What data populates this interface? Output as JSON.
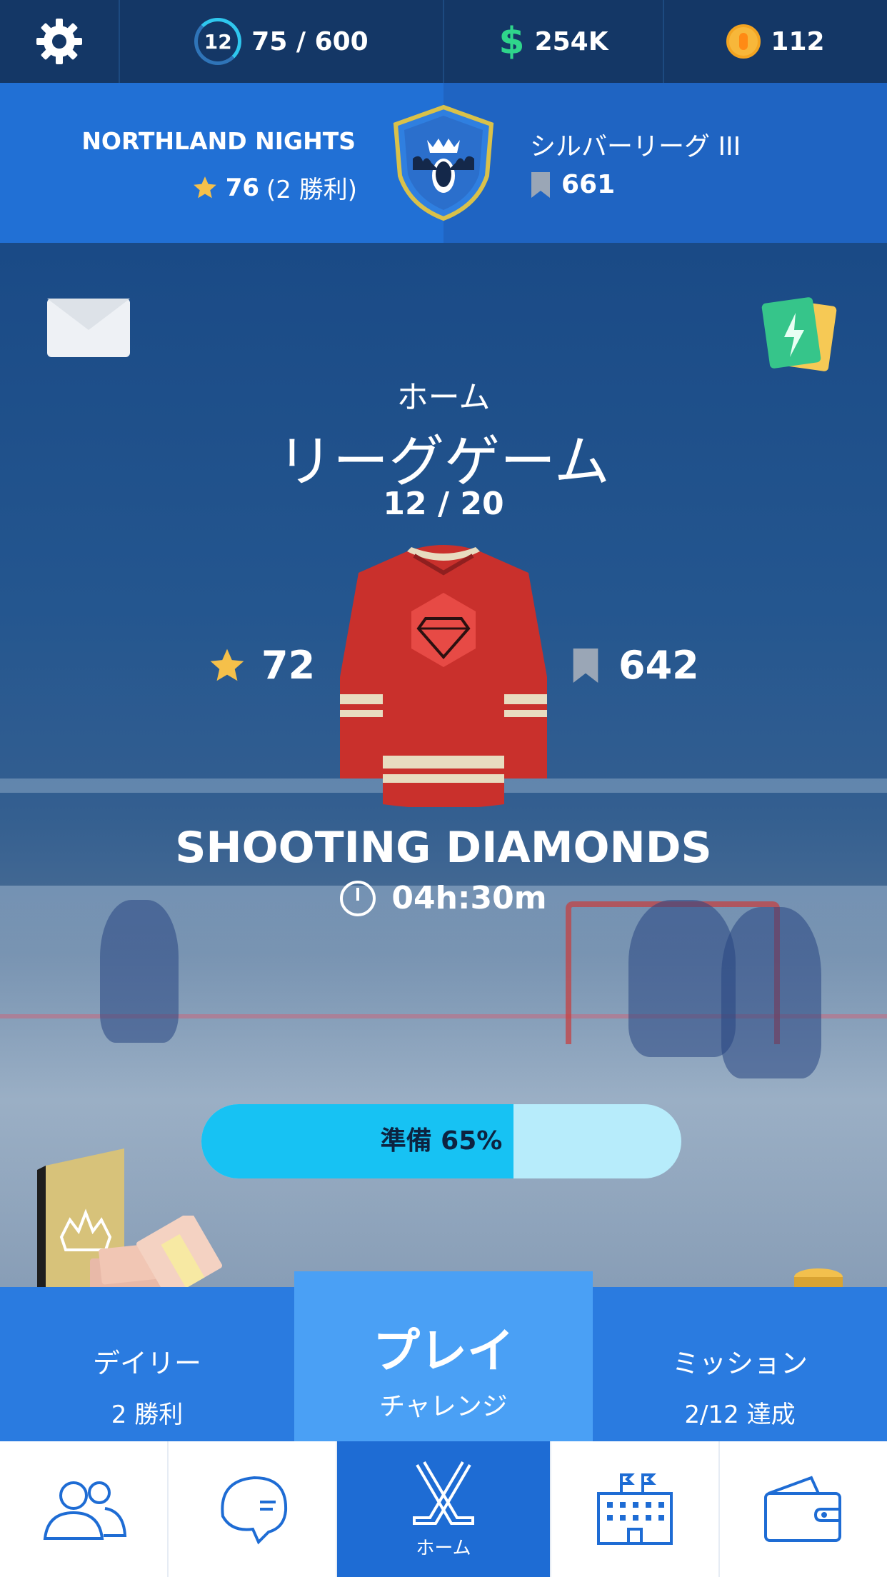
{
  "topbar": {
    "level": "12",
    "xp": "75 / 600",
    "cash": "254K",
    "coins": "112",
    "icons": {
      "settings": "gear-icon",
      "cash": "dollar-icon",
      "coins": "coin-icon"
    }
  },
  "team": {
    "name": "NORTHLAND NIGHTS",
    "stars": "76",
    "wins": "(2 勝利)",
    "league": "シルバーリーグ III",
    "league_points": "661"
  },
  "game": {
    "home_label": "ホーム",
    "title": "リーグゲーム",
    "count": "12 / 20",
    "opponent_stars": "72",
    "opponent_points": "642",
    "opponent_name": "SHOOTING DIAMONDS",
    "timer": "04h:30m",
    "ready_label": "準備 65%",
    "ready_percent": 65
  },
  "actions": {
    "daily_title": "デイリー",
    "daily_sub": "2 勝利",
    "play_title": "プレイ",
    "play_sub": "チャレンジ",
    "missions_title": "ミッション",
    "missions_sub": "2/12 達成"
  },
  "nav": {
    "home_label": "ホーム"
  },
  "colors": {
    "accent_blue": "#1e6cd4",
    "ready_fill": "#17c2f3",
    "jersey_red": "#c9302c",
    "cash_green": "#2fd58b",
    "coin_gold": "#f7b73a"
  }
}
